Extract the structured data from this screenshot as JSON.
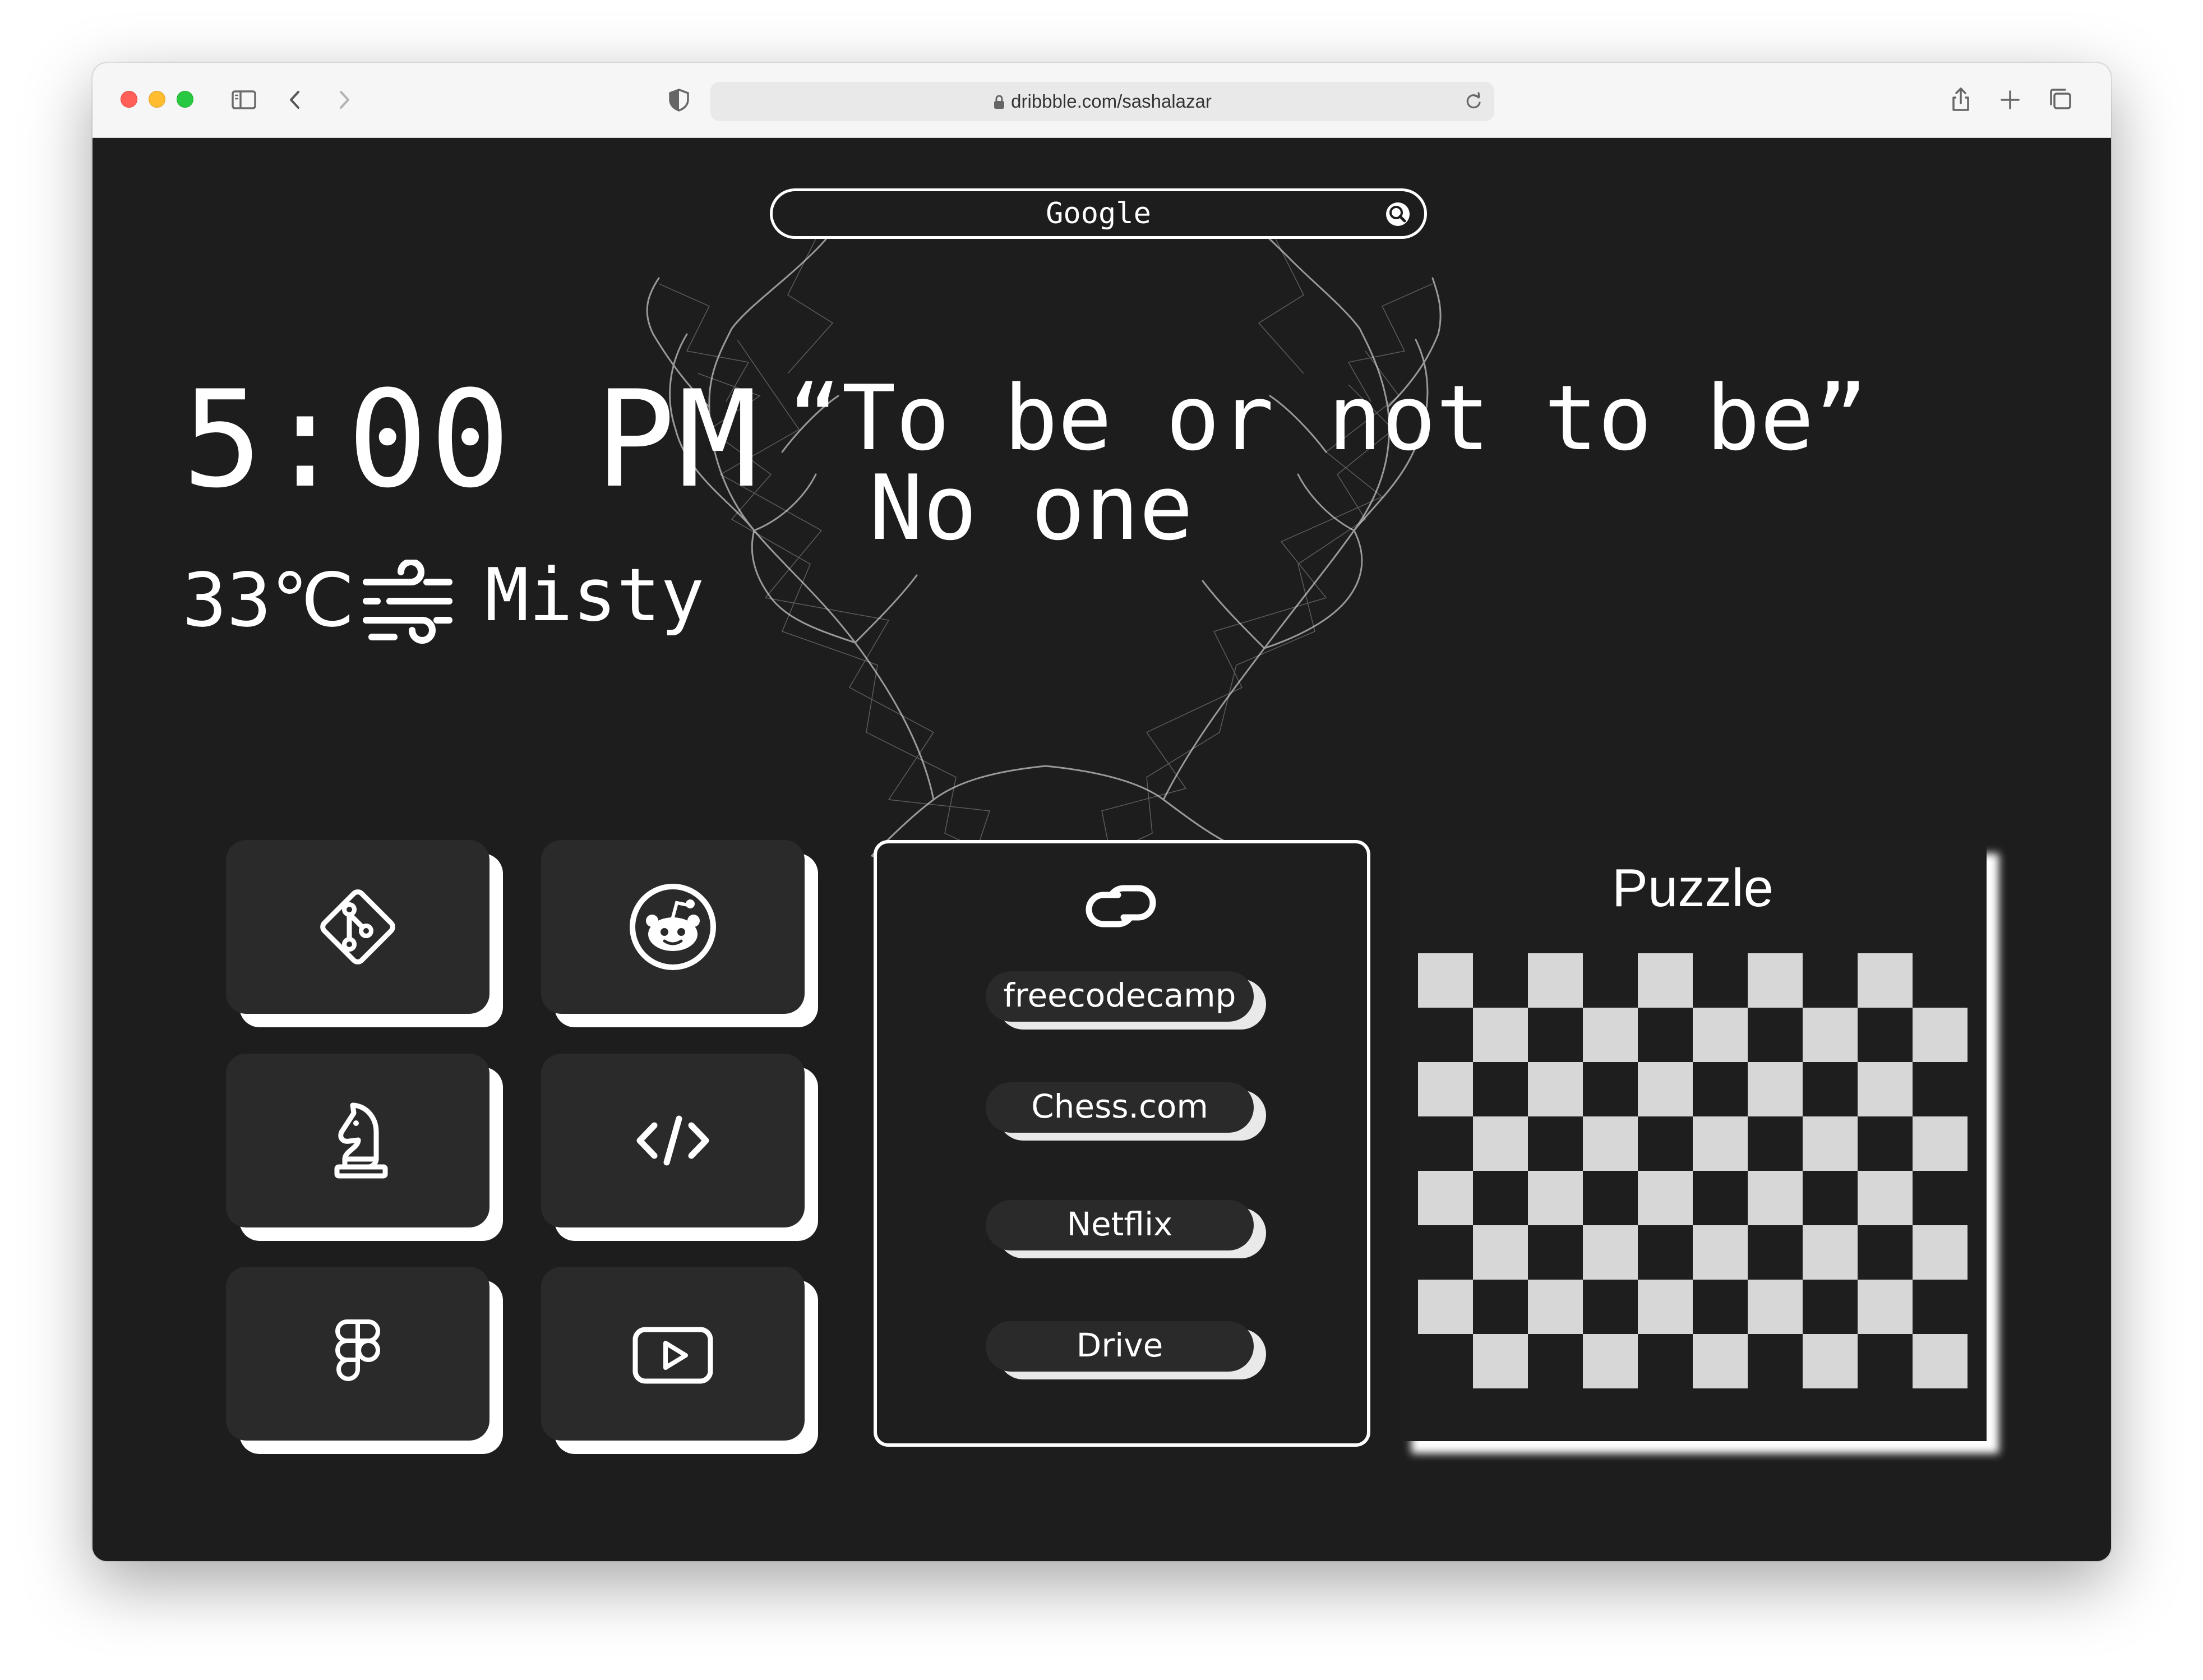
{
  "browser": {
    "url": "dribbble.com/sashalazar",
    "icons": [
      "sidebar-icon",
      "back-icon",
      "forward-icon",
      "shield-icon",
      "lock-icon",
      "reload-icon",
      "share-icon",
      "new-tab-icon",
      "tabs-overview-icon"
    ]
  },
  "search": {
    "label": "Google",
    "icon": "search-icon"
  },
  "clock": {
    "time": "5:00 PM"
  },
  "weather": {
    "temperature": "33℃",
    "condition": "Misty",
    "icon": "wind-icon"
  },
  "quote": {
    "text": "“To be or not to be”",
    "author": "No one"
  },
  "apps": [
    {
      "name": "git",
      "icon": "git-icon"
    },
    {
      "name": "reddit",
      "icon": "reddit-icon"
    },
    {
      "name": "chess",
      "icon": "chess-knight-icon"
    },
    {
      "name": "code",
      "icon": "code-icon"
    },
    {
      "name": "figma",
      "icon": "figma-icon"
    },
    {
      "name": "youtube",
      "icon": "youtube-icon"
    }
  ],
  "links": {
    "icon": "link-icon",
    "items": [
      "freecodecamp",
      "Chess.com",
      "Netflix",
      "Drive"
    ]
  },
  "puzzle": {
    "title": "Puzzle",
    "rows": 8,
    "cols": 10
  },
  "colors": {
    "background": "#1d1d1d",
    "foreground": "#ffffff",
    "tile": "#2a2a2a",
    "board_light": "#d7d7d7"
  }
}
